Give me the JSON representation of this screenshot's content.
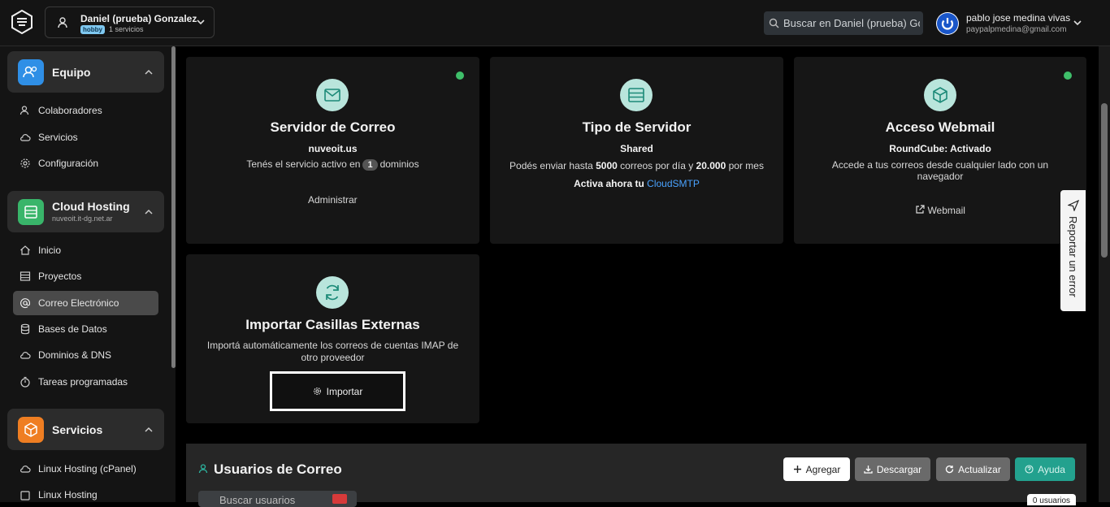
{
  "header": {
    "account_name": "Daniel (prueba) Gonzalez",
    "account_plan": "hobby",
    "account_services": "1 servicios",
    "search_placeholder": "Buscar en Daniel (prueba) Gonzalez",
    "user_name": "pablo jose medina vivas",
    "user_email": "paypalpmedina@gmail.com"
  },
  "sidebar": {
    "team": {
      "title": "Equipo",
      "items": [
        {
          "label": "Colaboradores",
          "icon": "users-icon"
        },
        {
          "label": "Servicios",
          "icon": "cloud-icon"
        },
        {
          "label": "Configuración",
          "icon": "gear-icon"
        }
      ]
    },
    "hosting": {
      "title": "Cloud Hosting",
      "subtitle": "nuveoit.it-dg.net.ar",
      "items": [
        {
          "label": "Inicio",
          "icon": "home-icon"
        },
        {
          "label": "Proyectos",
          "icon": "list-icon"
        },
        {
          "label": "Correo Electrónico",
          "icon": "at-icon",
          "active": true
        },
        {
          "label": "Bases de Datos",
          "icon": "database-icon"
        },
        {
          "label": "Dominios & DNS",
          "icon": "cloud-icon"
        },
        {
          "label": "Tareas programadas",
          "icon": "timer-icon"
        }
      ]
    },
    "services": {
      "title": "Servicios",
      "items": [
        {
          "label": "Linux Hosting (cPanel)",
          "icon": "cloud-icon"
        },
        {
          "label": "Linux Hosting",
          "icon": "square-icon"
        }
      ]
    }
  },
  "cards": {
    "mail_server": {
      "title": "Servidor de Correo",
      "domain": "nuveoit.us",
      "active_prefix": "Tenés el servicio activo en",
      "domain_count": "1",
      "active_suffix": "dominios",
      "action": "Administrar"
    },
    "server_type": {
      "title": "Tipo de Servidor",
      "type": "Shared",
      "limit_prefix": "Podés enviar hasta",
      "per_day": "5000",
      "limit_mid": "correos por día y",
      "per_month": "20.000",
      "limit_suffix": "por mes",
      "promo_prefix": "Activa ahora tu",
      "promo_link": "CloudSMTP"
    },
    "webmail": {
      "title": "Acceso Webmail",
      "status": "RoundCube: Activado",
      "description": "Accede a tus correos desde cualquier lado con un navegador",
      "action": "Webmail"
    },
    "import": {
      "title": "Importar Casillas Externas",
      "description": "Importá automáticamente los correos de cuentas IMAP de otro proveedor",
      "action": "Importar"
    }
  },
  "report": {
    "label": "Reportar un error"
  },
  "users": {
    "title": "Usuarios de Correo",
    "add": "Agregar",
    "download": "Descargar",
    "refresh": "Actualizar",
    "help": "Ayuda",
    "search_placeholder": "Buscar usuarios",
    "count": "0 usuarios"
  },
  "colors": {
    "accent": "#23a18e",
    "status_ok": "#3fbf6a",
    "link": "#4aa3ff"
  }
}
